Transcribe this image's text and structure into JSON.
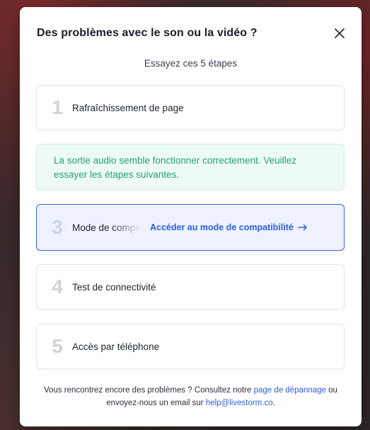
{
  "modal": {
    "title": "Des problèmes avec le son ou la vidéo ?",
    "subtitle": "Essayez ces 5 étapes"
  },
  "steps": [
    {
      "number": "1",
      "label": "Rafraîchissement de page"
    },
    {
      "number": "3",
      "label": "Mode de compatibilité",
      "action_label": "Accéder au mode de compatibilité",
      "action_icon": "arrow-right-icon"
    },
    {
      "number": "4",
      "label": "Test de connectivité"
    },
    {
      "number": "5",
      "label": "Accès par téléphone"
    }
  ],
  "notice": {
    "text": "La sortie audio semble fonctionner correctement. Veuillez essayer les étapes suivantes."
  },
  "footer": {
    "text_before": "Vous rencontrez encore des problèmes ? Consultez notre ",
    "link_troubleshoot": "page de dépannage",
    "text_middle": " ou envoyez-nous un email sur ",
    "link_email": "help@livestorm.co",
    "text_after": "."
  },
  "colors": {
    "accent": "#2f5fe0",
    "success_text": "#25a07a",
    "success_bg": "#eefaf5",
    "step_number": "#cfd4db"
  }
}
